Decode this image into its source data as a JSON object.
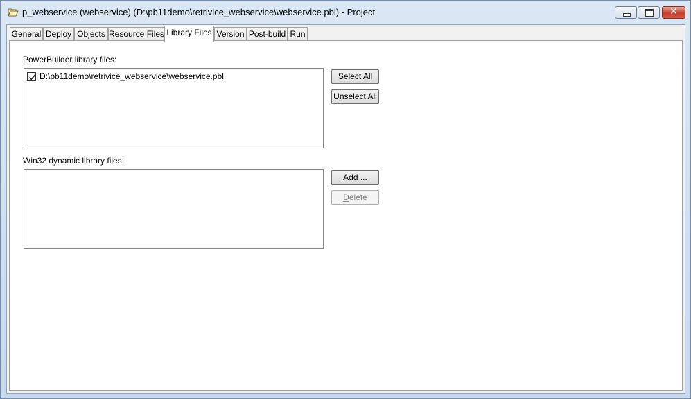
{
  "window": {
    "title": "p_webservice (webservice) (D:\\pb11demo\\retrivice_webservice\\webservice.pbl) - Project",
    "close_glyph": "✕"
  },
  "tabs": [
    {
      "label": "General"
    },
    {
      "label": "Deploy"
    },
    {
      "label": "Objects"
    },
    {
      "label": "Resource Files"
    },
    {
      "label": "Library Files",
      "active": true
    },
    {
      "label": "Version"
    },
    {
      "label": "Post-build"
    },
    {
      "label": "Run"
    }
  ],
  "pbl_section": {
    "label": "PowerBuilder library files:",
    "items": [
      {
        "checked": true,
        "path": "D:\\pb11demo\\retrivice_webservice\\webservice.pbl"
      }
    ],
    "select_all": {
      "accel": "S",
      "rest": "elect All"
    },
    "unselect_all": {
      "accel": "U",
      "rest": "nselect All"
    }
  },
  "dll_section": {
    "label": "Win32 dynamic library files:",
    "items": [],
    "add": {
      "accel": "A",
      "rest": "dd ..."
    },
    "delete": {
      "accel": "D",
      "rest": "elete",
      "disabled": true
    }
  },
  "icons": {
    "app": "folder-open-icon",
    "check": "checkmark-icon"
  }
}
